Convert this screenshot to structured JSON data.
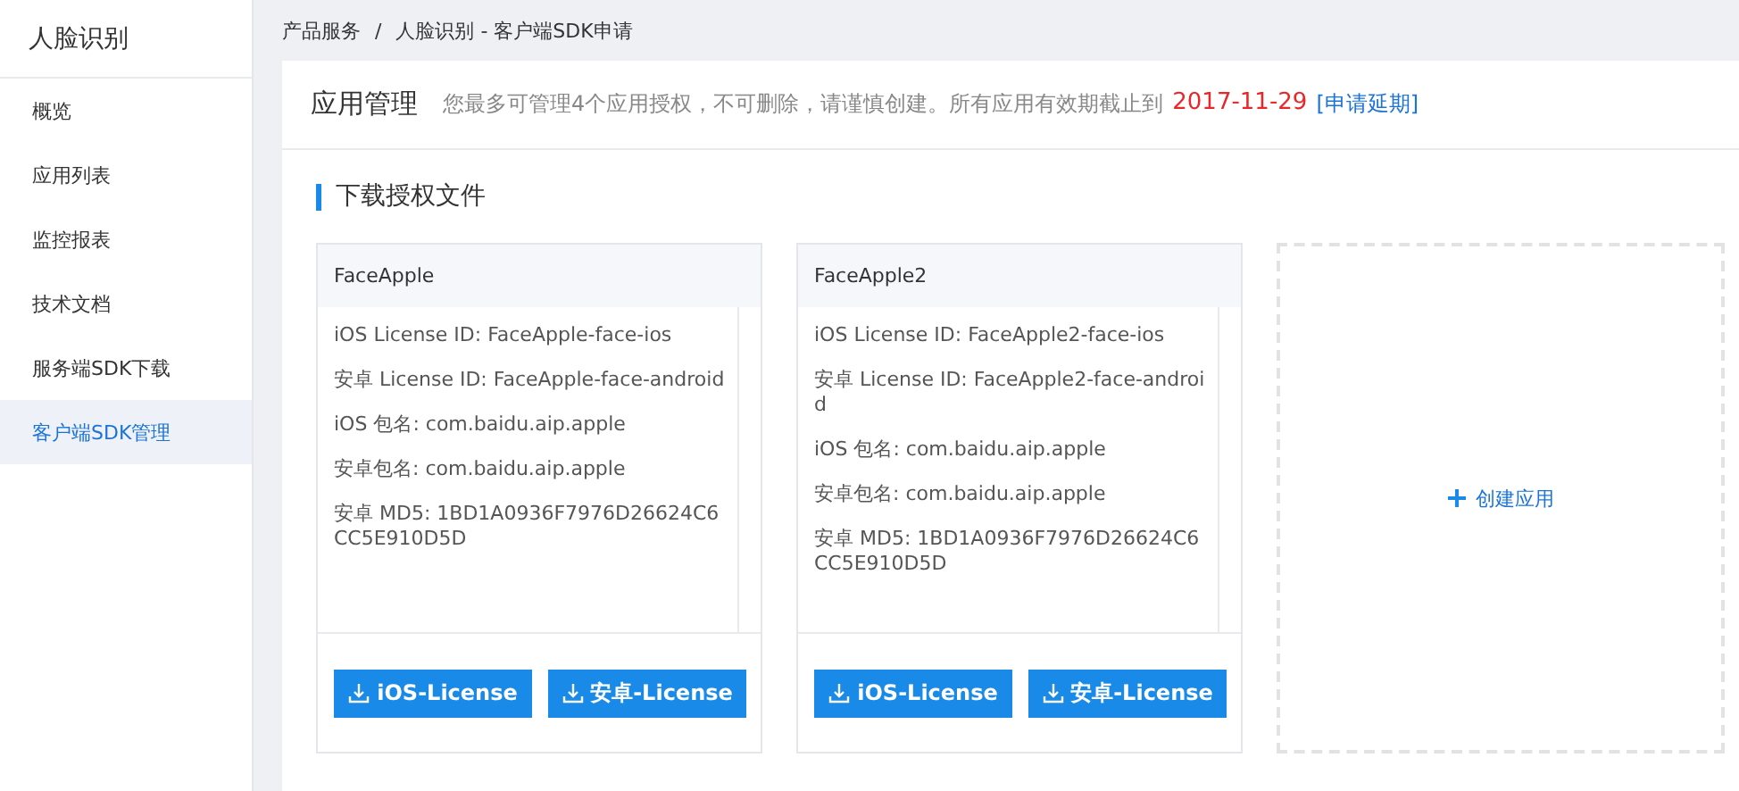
{
  "sidebar": {
    "title": "人脸识别",
    "items": [
      {
        "label": "概览",
        "selected": false
      },
      {
        "label": "应用列表",
        "selected": false
      },
      {
        "label": "监控报表",
        "selected": false
      },
      {
        "label": "技术文档",
        "selected": false
      },
      {
        "label": "服务端SDK下载",
        "selected": false
      },
      {
        "label": "客户端SDK管理",
        "selected": true
      }
    ]
  },
  "breadcrumb": {
    "parent": "产品服务",
    "separator": "/",
    "current": "人脸识别 - 客户端SDK申请"
  },
  "header": {
    "title": "应用管理",
    "notice": "您最多可管理4个应用授权，不可删除，请谨慎创建。所有应用有效期截止到",
    "date": "2017-11-29",
    "link": "[申请延期]"
  },
  "section_title": "下载授权文件",
  "apps": [
    {
      "name": "FaceApple",
      "fields": [
        "iOS License ID: FaceApple-face-ios",
        "安卓 License ID: FaceApple-face-android",
        "iOS 包名: com.baidu.aip.apple",
        "安卓包名: com.baidu.aip.apple",
        "安卓 MD5: 1BD1A0936F7976D26624C6CC5E910D5D"
      ],
      "buttons": [
        "iOS-License",
        "安卓-License"
      ]
    },
    {
      "name": "FaceApple2",
      "fields": [
        "iOS License ID: FaceApple2-face-ios",
        "安卓 License ID: FaceApple2-face-android",
        "iOS 包名: com.baidu.aip.apple",
        "安卓包名: com.baidu.aip.apple",
        "安卓 MD5: 1BD1A0936F7976D26624C6CC5E910D5D"
      ],
      "buttons": [
        "iOS-License",
        "安卓-License"
      ]
    }
  ],
  "create_button": "创建应用"
}
